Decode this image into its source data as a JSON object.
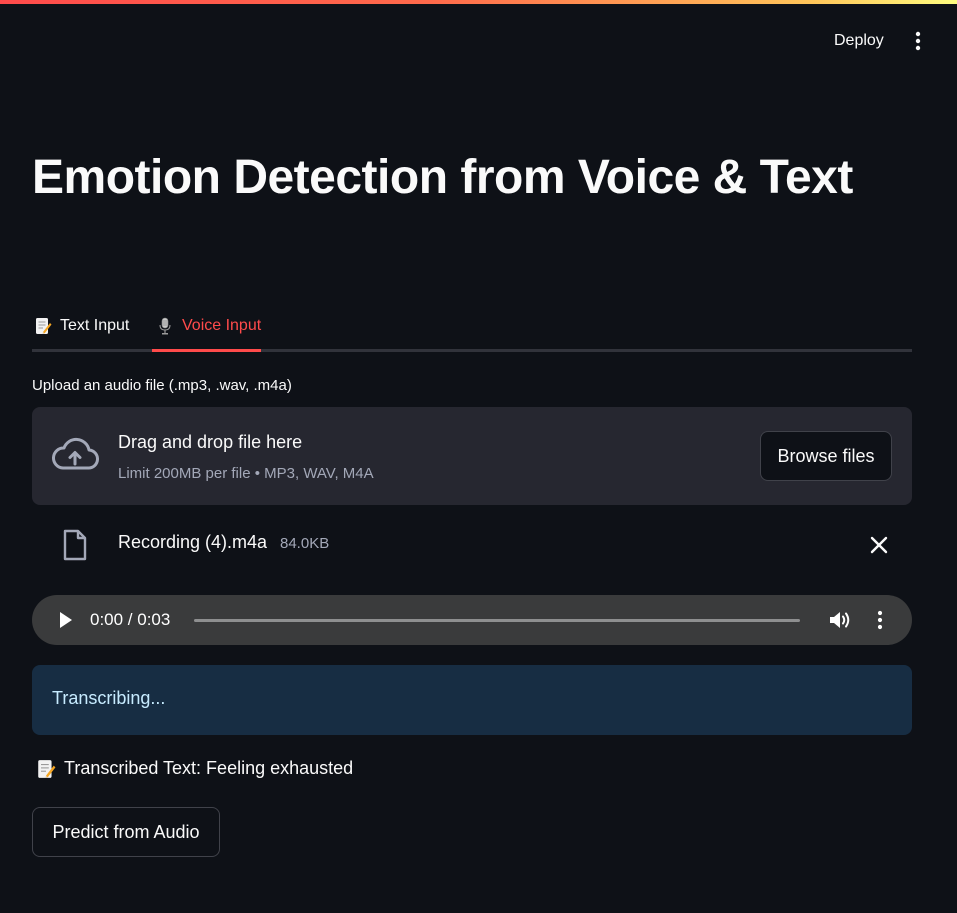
{
  "header": {
    "deploy_label": "Deploy",
    "menu_icon": "vertical-ellipsis-icon"
  },
  "page": {
    "title": "Emotion Detection from Voice & Text"
  },
  "tabs": [
    {
      "label": "Text Input",
      "icon": "memo-icon",
      "active": false
    },
    {
      "label": "Voice Input",
      "icon": "microphone-icon",
      "active": true
    }
  ],
  "uploader": {
    "label": "Upload an audio file (.mp3, .wav, .m4a)",
    "drop_title": "Drag and drop file here",
    "drop_subtitle": "Limit 200MB per file • MP3, WAV, M4A",
    "browse_label": "Browse files",
    "icon": "cloud-upload-icon"
  },
  "uploaded_file": {
    "name": "Recording (4).m4a",
    "size": "84.0KB",
    "icon": "file-icon",
    "remove_icon": "close-icon"
  },
  "audio_player": {
    "time": "0:00 / 0:03",
    "progress": 0
  },
  "status": {
    "message": "Transcribing..."
  },
  "transcription": {
    "text": "Transcribed Text: Feeling exhausted",
    "icon": "memo-icon"
  },
  "actions": {
    "predict_label": "Predict from Audio"
  },
  "colors": {
    "background": "#0e1117",
    "accent": "#ff4b4b",
    "dropzone": "#262730",
    "info_bg": "#172d43",
    "info_text": "#c7ebff"
  }
}
